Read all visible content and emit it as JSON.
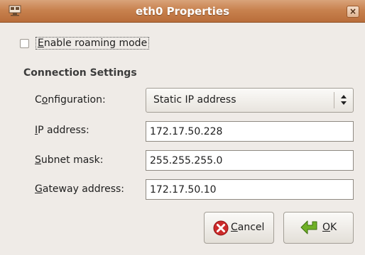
{
  "window": {
    "title": "eth0 Properties",
    "close_glyph": "×",
    "icon": "network-card-icon"
  },
  "roaming": {
    "checked": false,
    "label_accel": "E",
    "label_rest": "nable roaming mode"
  },
  "connection_settings": {
    "title": "Connection Settings",
    "configuration": {
      "label_pre": "C",
      "label_accel": "o",
      "label_rest": "nfiguration:",
      "value": "Static IP address"
    },
    "ip_address": {
      "label_accel": "I",
      "label_rest": "P address:",
      "value": "172.17.50.228"
    },
    "subnet_mask": {
      "label_accel": "S",
      "label_rest": "ubnet mask:",
      "value": "255.255.255.0"
    },
    "gateway_address": {
      "label_accel": "G",
      "label_rest": "ateway address:",
      "value": "172.17.50.10"
    }
  },
  "buttons": {
    "cancel": {
      "label_accel": "C",
      "label_rest": "ancel",
      "icon": "cancel-icon"
    },
    "ok": {
      "label_accel": "O",
      "label_rest": "K",
      "icon": "ok-icon"
    }
  },
  "colors": {
    "titlebar": "#c8824f",
    "dialog_bg": "#efebe7",
    "cancel_red": "#cc2a2a",
    "ok_green": "#6fb026"
  }
}
